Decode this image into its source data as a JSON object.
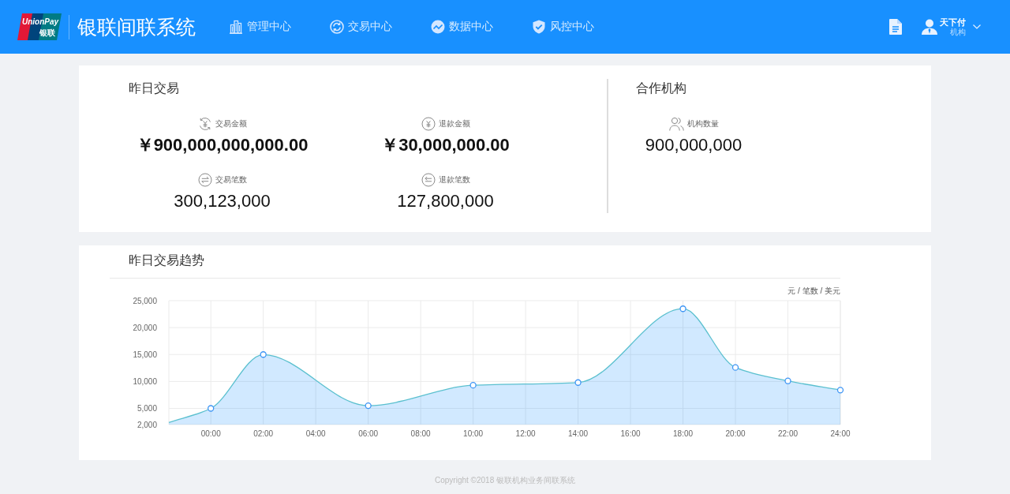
{
  "header": {
    "logo": {
      "wordmark": "UnionPay",
      "text": "银联"
    },
    "title": "银联间联系统",
    "nav": [
      {
        "label": "管理中心"
      },
      {
        "label": "交易中心"
      },
      {
        "label": "数据中心"
      },
      {
        "label": "风控中心"
      }
    ],
    "user": {
      "name": "天下付",
      "role": "机构"
    }
  },
  "yesterday": {
    "title": "昨日交易",
    "stats": [
      {
        "label": "交易金额",
        "value": "￥900,000,000,000.00",
        "kind": "amount"
      },
      {
        "label": "退款金额",
        "value": "￥30,000,000.00",
        "kind": "amount"
      },
      {
        "label": "交易笔数",
        "value": "300,123,000",
        "kind": "count"
      },
      {
        "label": "退款笔数",
        "value": "127,800,000",
        "kind": "count"
      }
    ]
  },
  "partners": {
    "title": "合作机构",
    "stats": [
      {
        "label": "机构数量",
        "value": "900,000,000",
        "kind": "count"
      }
    ]
  },
  "trend": {
    "title": "昨日交易趋势",
    "chart_data": {
      "type": "area",
      "ylabel": "元 / 笔数 / 美元",
      "grid": true,
      "x": [
        -1.6,
        0,
        2,
        6,
        10,
        14,
        18,
        20,
        22,
        24
      ],
      "xlim": [
        -1.6,
        24
      ],
      "ylim": [
        2000,
        25000
      ],
      "xticks": [
        {
          "value": 0,
          "label": "00:00"
        },
        {
          "value": 2,
          "label": "02:00"
        },
        {
          "value": 4,
          "label": "04:00"
        },
        {
          "value": 6,
          "label": "06:00"
        },
        {
          "value": 8,
          "label": "08:00"
        },
        {
          "value": 10,
          "label": "10:00"
        },
        {
          "value": 12,
          "label": "12:00"
        },
        {
          "value": 14,
          "label": "14:00"
        },
        {
          "value": 16,
          "label": "16:00"
        },
        {
          "value": 18,
          "label": "18:00"
        },
        {
          "value": 20,
          "label": "20:00"
        },
        {
          "value": 22,
          "label": "22:00"
        },
        {
          "value": 24,
          "label": "24:00"
        }
      ],
      "yticks": [
        {
          "value": 2000,
          "label": "2,000"
        },
        {
          "value": 5000,
          "label": "5,000"
        },
        {
          "value": 10000,
          "label": "10,000"
        },
        {
          "value": 15000,
          "label": "15,000"
        },
        {
          "value": 20000,
          "label": "20,000"
        },
        {
          "value": 25000,
          "label": "25,000"
        }
      ],
      "series": [
        {
          "color": "#5bc0cf",
          "values": [
            2400,
            5000,
            15000,
            5500,
            9300,
            9800,
            23500,
            12600,
            10100,
            8400
          ]
        }
      ]
    }
  },
  "footer": "Copyright ©2018 银联机构业务间联系统"
}
